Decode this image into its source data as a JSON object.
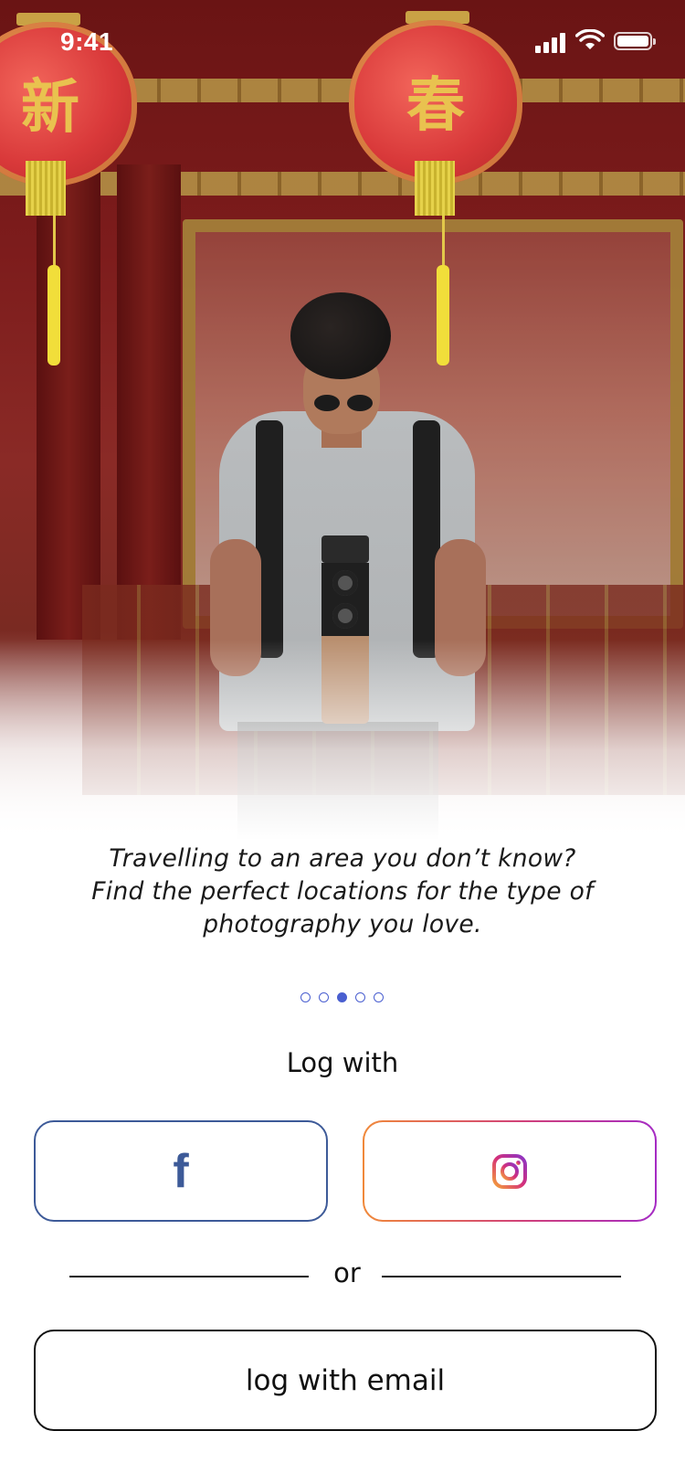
{
  "status_bar": {
    "time": "9:41",
    "icons": [
      "cellular-signal-icon",
      "wifi-icon",
      "battery-icon"
    ]
  },
  "hero": {
    "lantern_left_glyph": "新",
    "lantern_right_glyph": "春"
  },
  "onboarding": {
    "tagline_lines": [
      "Travelling to an area you don’t know?",
      "Find the perfect locations for the type of",
      "photography you love."
    ],
    "pagination": {
      "total": 5,
      "current": 3
    }
  },
  "login": {
    "log_with_label": "Log with",
    "facebook_icon": "facebook-icon",
    "instagram_icon": "instagram-icon",
    "or_label": "or",
    "email_button_label": "log with email"
  },
  "colors": {
    "accent": "#4a5fd0",
    "facebook": "#3d5a98",
    "instagram_gradient": [
      "#f0893a",
      "#d0407a",
      "#a52bc4"
    ],
    "text": "#111111"
  }
}
